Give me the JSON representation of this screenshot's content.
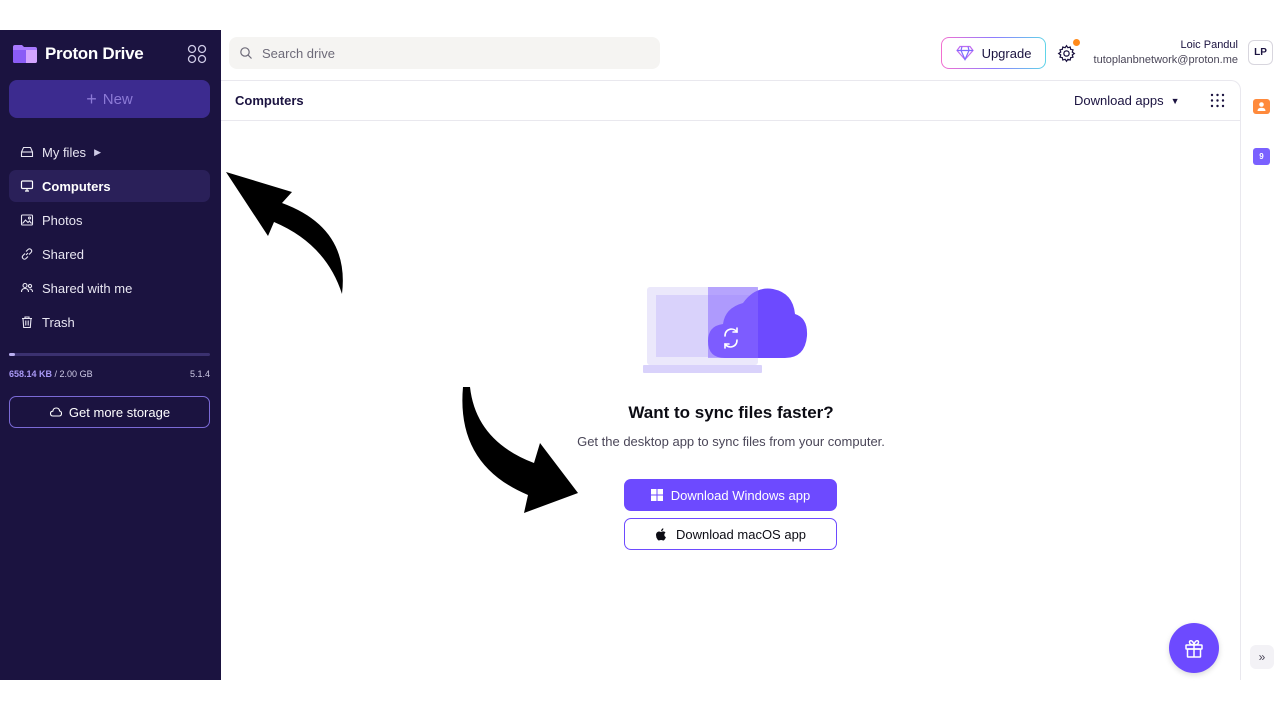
{
  "app": {
    "name": "Proton Drive"
  },
  "sidebar": {
    "new_label": "New",
    "items": [
      {
        "label": "My files",
        "icon": "drive-icon",
        "has_caret": true
      },
      {
        "label": "Computers",
        "icon": "monitor-icon",
        "active": true
      },
      {
        "label": "Photos",
        "icon": "image-icon"
      },
      {
        "label": "Shared",
        "icon": "link-icon"
      },
      {
        "label": "Shared with me",
        "icon": "users-icon"
      },
      {
        "label": "Trash",
        "icon": "trash-icon"
      }
    ],
    "storage": {
      "used": "658.14 KB",
      "separator": " / ",
      "total": "2.00 GB",
      "used_fraction": 0.0003
    },
    "version": "5.1.4",
    "more_storage_label": "Get more storage"
  },
  "topbar": {
    "search_placeholder": "Search drive",
    "upgrade_label": "Upgrade",
    "user_name": "Loic Pandul",
    "user_email": "tutoplanbnetwork@proton.me",
    "avatar_initials": "LP"
  },
  "main": {
    "title": "Computers",
    "download_apps_label": "Download apps",
    "empty_title": "Want to sync files faster?",
    "empty_subtitle": "Get the desktop app to sync files from your computer.",
    "download_windows_label": "Download Windows app",
    "download_macos_label": "Download macOS app"
  },
  "rail": {
    "calendar_day": "9"
  },
  "colors": {
    "sidebar_bg": "#1b1340",
    "accent": "#6d4aff",
    "new_button_bg": "#3c2b8f",
    "notification_dot": "#ff8a1a"
  }
}
